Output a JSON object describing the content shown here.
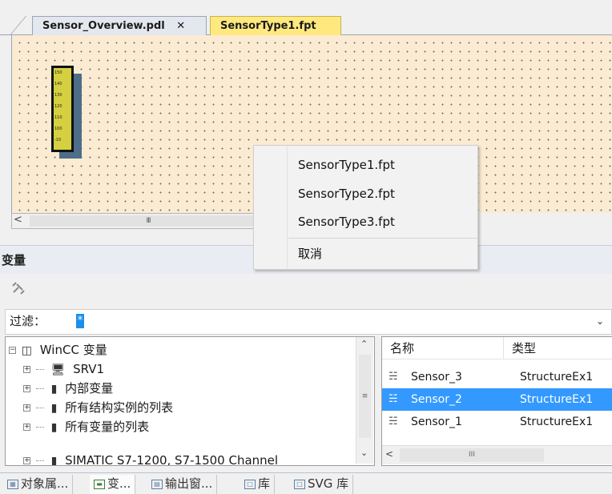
{
  "tabs": [
    {
      "label": "Sensor_Overview.pdl",
      "close": "✕"
    },
    {
      "label": "SensorType1.fpt"
    }
  ],
  "canvas": {
    "scrollbar_thumb": "III",
    "sensor_ticks": [
      "150",
      "140",
      "130",
      "120",
      "110",
      "100",
      "-10"
    ]
  },
  "context_menu": {
    "items": [
      "SensorType1.fpt",
      "SensorType2.fpt",
      "SensorType3.fpt",
      "取消"
    ]
  },
  "variables_panel": {
    "title": "变量",
    "filter_label": "过滤：",
    "filter_value": "*",
    "tree": [
      {
        "label": "WinCC 变量",
        "icon": "project-icon",
        "expander": "−"
      },
      {
        "label": "SRV1",
        "icon": "server-icon",
        "expander": "+"
      },
      {
        "label": "内部变量",
        "icon": "tag-group-icon",
        "expander": "+"
      },
      {
        "label": "所有结构实例的列表",
        "icon": "tag-group-icon",
        "expander": "+"
      },
      {
        "label": "所有变量的列表",
        "icon": "tag-group-icon",
        "expander": "+"
      },
      {
        "label": "SIMATIC S7-1200, S7-1500 Channel",
        "icon": "tag-group-icon",
        "expander": "+"
      }
    ],
    "table": {
      "columns": [
        "名称",
        "类型"
      ],
      "rows": [
        {
          "name": "Sensor_3",
          "type": "StructureEx1"
        },
        {
          "name": "Sensor_2",
          "type": "StructureEx1",
          "selected": true
        },
        {
          "name": "Sensor_1",
          "type": "StructureEx1"
        }
      ],
      "scrollbar_thumb": "III"
    }
  },
  "bottom_tabs": [
    "对象属...",
    "变...",
    "输出窗...",
    "库",
    "SVG 库"
  ],
  "colors": {
    "canvas_bg": "#fbebd3",
    "active_tab": "#ffe97f",
    "selection": "#3399ff"
  }
}
